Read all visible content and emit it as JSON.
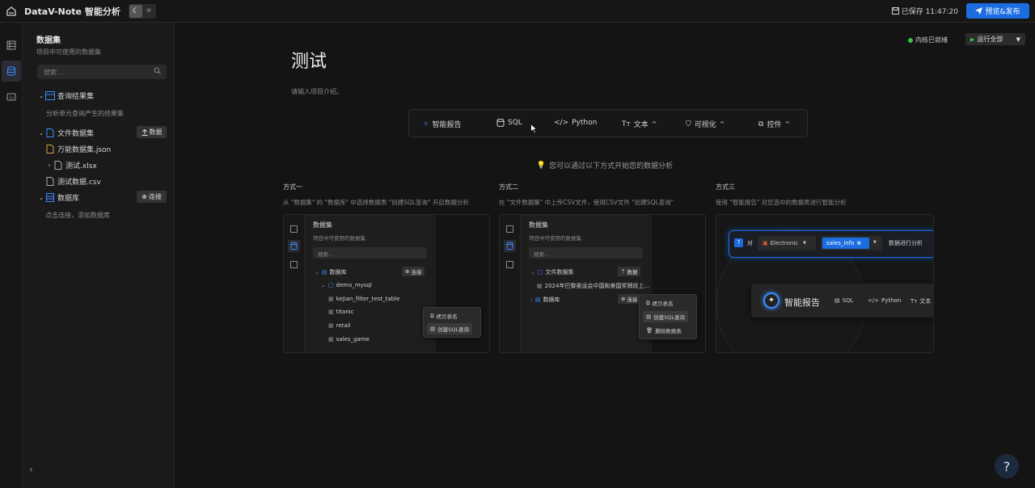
{
  "header": {
    "app_title": "DataV-Note 智能分析",
    "saved_status": "已保存 11:47:20",
    "publish_label": "预览&发布"
  },
  "sidebar": {
    "title": "数据集",
    "subtitle": "项目中可使用的数据集",
    "search_placeholder": "搜索...",
    "query_results": {
      "label": "查询结果集",
      "note": "分析单元查询产生的结果集"
    },
    "file_datasets": {
      "label": "文件数据集",
      "button": "数据",
      "files": [
        "万能数据集.json",
        "测试.xlsx",
        "测试数据.csv"
      ]
    },
    "databases": {
      "label": "数据库",
      "button": "连接",
      "note": "点击连接，添加数据库"
    }
  },
  "main": {
    "kernel_status": "内核已就绪",
    "run_all_label": "运行全部",
    "doc_title": "测试",
    "doc_description": "请输入项目介绍。",
    "toolbar": {
      "smart_report": "智能报告",
      "sql": "SQL",
      "python": "Python",
      "text": "文本",
      "visualize": "可视化",
      "widget": "控件"
    },
    "hint": "您可以通过以下方式开始您的数据分析",
    "ways": [
      {
        "title": "方式一",
        "desc": "从 \"数据集\" 的 \"数据库\" 中选择数据表 \"创建SQL查询\" 开启数据分析"
      },
      {
        "title": "方式二",
        "desc": "在 \"文件数据集\" 中上传CSV文件，使用CSV文件 \"创建SQL查询\""
      },
      {
        "title": "方式三",
        "desc": "使用 \"智能报告\" 对您选中的数据表进行智能分析"
      }
    ],
    "preview1": {
      "title": "数据集",
      "subtitle": "项目中可使用的数据集",
      "search": "搜索...",
      "db_label": "数据库",
      "connect": "连接",
      "schema": "demo_mysql",
      "tables": [
        "kejian_filter_test_table",
        "titanic",
        "retail",
        "sales_game"
      ],
      "ctx_copy": "拷贝表名",
      "ctx_create": "创建SQL查询"
    },
    "preview2": {
      "title": "数据集",
      "subtitle": "项目中可使用的数据集",
      "search": "搜索...",
      "file_label": "文件数据集",
      "data_btn": "数据",
      "file_item": "2024年巴黎奥运会中国和美国奖牌段上...",
      "db_label": "数据库",
      "connect_btn": "连接",
      "ctx_copy": "拷贝表名",
      "ctx_create": "创建SQL查询",
      "ctx_delete": "删除数据表"
    },
    "preview3": {
      "against": "对",
      "source": "Electronic",
      "table": "sales_info",
      "action": "数据进行分析",
      "smart_report": "智能报告",
      "sql": "SQL",
      "python": "Python",
      "text": "文本"
    }
  },
  "help_label": "?"
}
